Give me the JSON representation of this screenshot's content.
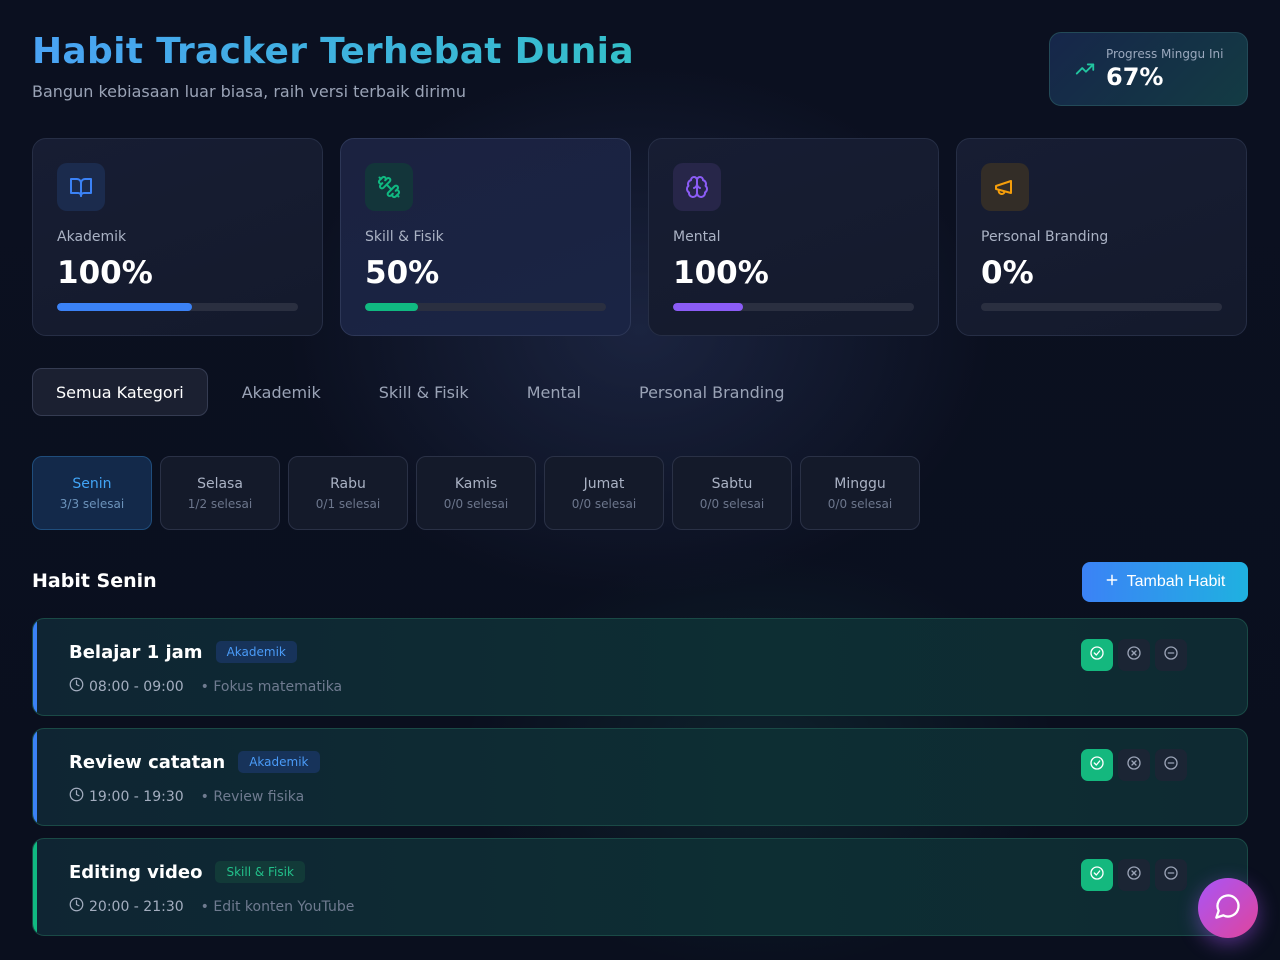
{
  "header": {
    "title": "Habit Tracker Terhebat Dunia",
    "subtitle": "Bangun kebiasaan luar biasa, raih versi terbaik dirimu",
    "weekly_progress": {
      "label": "Progress Minggu Ini",
      "value": "67%",
      "icon": "trending-up-icon"
    }
  },
  "stats": [
    {
      "label": "Akademik",
      "value": "100%",
      "bar_fraction": 0.56,
      "color": "#3b82f6",
      "icon": "book-open-icon"
    },
    {
      "label": "Skill & Fisik",
      "value": "50%",
      "bar_fraction": 0.22,
      "color": "#10b981",
      "icon": "dumbbell-icon"
    },
    {
      "label": "Mental",
      "value": "100%",
      "bar_fraction": 0.29,
      "color": "#8b5cf6",
      "icon": "brain-icon"
    },
    {
      "label": "Personal Branding",
      "value": "0%",
      "bar_fraction": 0.0,
      "color": "#f59e0b",
      "icon": "megaphone-icon"
    }
  ],
  "category_tabs": [
    "Semua Kategori",
    "Akademik",
    "Skill & Fisik",
    "Mental",
    "Personal Branding"
  ],
  "days": [
    {
      "name": "Senin",
      "count": "3/3 selesai"
    },
    {
      "name": "Selasa",
      "count": "1/2 selesai"
    },
    {
      "name": "Rabu",
      "count": "0/1 selesai"
    },
    {
      "name": "Kamis",
      "count": "0/0 selesai"
    },
    {
      "name": "Jumat",
      "count": "0/0 selesai"
    },
    {
      "name": "Sabtu",
      "count": "0/0 selesai"
    },
    {
      "name": "Minggu",
      "count": "0/0 selesai"
    }
  ],
  "section": {
    "title": "Habit Senin",
    "add_label": "Tambah Habit"
  },
  "habits": [
    {
      "title": "Belajar 1 jam",
      "tag": "Akademik",
      "time": "08:00 - 09:00",
      "note": "• Fokus matematika",
      "accent": "#3b82f6"
    },
    {
      "title": "Review catatan",
      "tag": "Akademik",
      "time": "19:00 - 19:30",
      "note": "• Review fisika",
      "accent": "#3b82f6"
    },
    {
      "title": "Editing video",
      "tag": "Skill & Fisik",
      "time": "20:00 - 21:30",
      "note": "• Edit konten YouTube",
      "accent": "#10b981"
    }
  ],
  "colors": {
    "akademik": "#3b82f6",
    "skill_fisik": "#10b981",
    "mental": "#8b5cf6",
    "personal_branding": "#f59e0b",
    "done": "#14b87e"
  }
}
